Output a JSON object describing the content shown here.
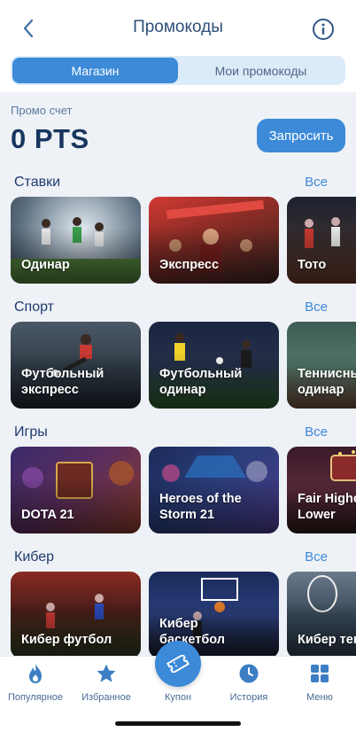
{
  "header": {
    "title": "Промокоды",
    "back_icon": "chevron-left-icon",
    "info_icon": "info-icon"
  },
  "segments": [
    {
      "label": "Магазин",
      "active": true
    },
    {
      "label": "Мои промокоды",
      "active": false
    }
  ],
  "promo": {
    "label": "Промо счет",
    "value": "0 PTS",
    "request_label": "Запросить"
  },
  "colors": {
    "accent": "#3c8ad8",
    "text_dark": "#17355f",
    "content_bg": "#eef1f6"
  },
  "sections": [
    {
      "title": "Ставки",
      "all_label": "Все",
      "cards": [
        {
          "label": "Одинар"
        },
        {
          "label": "Экспресс"
        },
        {
          "label": "Тото"
        }
      ]
    },
    {
      "title": "Спорт",
      "all_label": "Все",
      "cards": [
        {
          "label": "Футбольный\nэкспресс"
        },
        {
          "label": "Футбольный\nодинар"
        },
        {
          "label": "Теннисный\nодинар"
        }
      ]
    },
    {
      "title": "Игры",
      "all_label": "Все",
      "cards": [
        {
          "label": "DOTA 21"
        },
        {
          "label": "Heroes of the\nStorm 21"
        },
        {
          "label": "Fair Higher\nLower"
        }
      ]
    },
    {
      "title": "Кибер",
      "all_label": "Все",
      "cards": [
        {
          "label": "Кибер футбол"
        },
        {
          "label": "Кибер\nбаскетбол"
        },
        {
          "label": "Кибер теннис"
        }
      ]
    }
  ],
  "tabbar": {
    "items": [
      {
        "label": "Популярное",
        "icon": "flame-icon"
      },
      {
        "label": "Избранное",
        "icon": "star-icon"
      },
      {
        "label": "Купон",
        "icon": "ticket-icon"
      },
      {
        "label": "История",
        "icon": "clock-icon"
      },
      {
        "label": "Меню",
        "icon": "grid-icon"
      }
    ]
  }
}
